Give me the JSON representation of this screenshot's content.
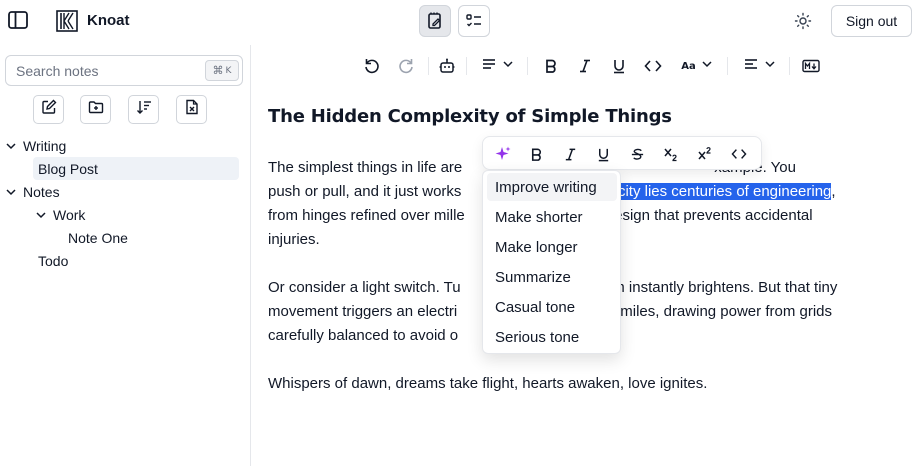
{
  "app": {
    "name": "Knoat"
  },
  "header": {
    "sign_out_label": "Sign out"
  },
  "sidebar": {
    "search": {
      "placeholder": "Search notes",
      "shortcut_symbol": "⌘",
      "shortcut_key": "K"
    },
    "actions": [
      "new-note",
      "new-folder",
      "sort",
      "delete"
    ],
    "tree": [
      {
        "label": "Writing",
        "expanded": true
      },
      {
        "label": "Blog Post",
        "selected": true
      },
      {
        "label": "Notes",
        "expanded": true
      },
      {
        "label": "Work",
        "expanded": true
      },
      {
        "label": "Note One"
      },
      {
        "label": "Todo"
      }
    ]
  },
  "editor": {
    "title": "The Hidden Complexity of Simple Things",
    "para1_l1": "The simplest things in life are",
    "para1_l1_tail": "xample. You",
    "para1_l2_pre": "push or pull, and it just works",
    "para1_l2_hl": "mplicity lies centuries of engineering",
    "para1_l2_post": ",",
    "para1_l3_pre": "from hinges refined over mille",
    "para1_l3_post": "design that prevents accidental",
    "para1_l4": "injuries.",
    "para2_l1_pre": "Or consider a light switch. Tu",
    "para2_l1_post": "oom instantly brightens. But that tiny",
    "para2_l2_pre": "movement triggers an electri",
    "para2_l2_post": "ns miles, drawing power from grids",
    "para2_l3_pre": "carefully balanced to avoid o",
    "para3": "Whispers of dawn, dreams take flight, hearts awaken, love ignites."
  },
  "ai_menu": {
    "items": [
      "Improve writing",
      "Make shorter",
      "Make longer",
      "Summarize",
      "Casual tone",
      "Serious tone"
    ]
  },
  "colors": {
    "accent": "#2563eb",
    "ai_sparkle": "#9333ea"
  }
}
